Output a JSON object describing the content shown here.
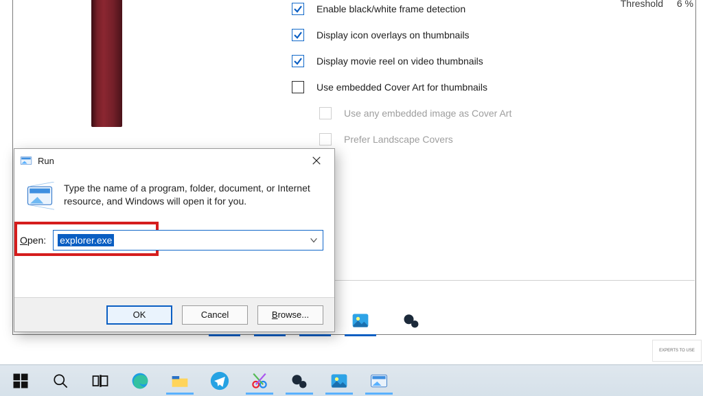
{
  "bg": {
    "options": [
      {
        "label": "Enable black/white frame detection",
        "checked": true,
        "sub": false,
        "faded": false
      },
      {
        "label": "Display icon overlays on thumbnails",
        "checked": true,
        "sub": false,
        "faded": false
      },
      {
        "label": "Display movie reel on video thumbnails",
        "checked": true,
        "sub": false,
        "faded": false
      },
      {
        "label": "Use embedded Cover Art for thumbnails",
        "checked": false,
        "sub": false,
        "faded": false
      },
      {
        "label": "Use any embedded image as Cover Art",
        "checked": false,
        "sub": true,
        "faded": true
      },
      {
        "label": "Prefer Landscape Covers",
        "checked": false,
        "sub": true,
        "faded": true
      }
    ],
    "threshold_label": "Threshold",
    "threshold_value": "6 %"
  },
  "run": {
    "title": "Run",
    "description": "Type the name of a program, folder, document, or Internet resource, and Windows will open it for you.",
    "open_label_prefix": "O",
    "open_label_rest": "pen:",
    "input_value": "explorer.exe",
    "buttons": {
      "ok": "OK",
      "cancel": "Cancel",
      "browse_prefix": "B",
      "browse_rest": "rowse..."
    }
  },
  "taskbar": {
    "items": [
      {
        "name": "start",
        "running": false
      },
      {
        "name": "search",
        "running": false
      },
      {
        "name": "task-view",
        "running": false
      },
      {
        "name": "edge",
        "running": false
      },
      {
        "name": "file-explorer",
        "running": true
      },
      {
        "name": "telegram",
        "running": false
      },
      {
        "name": "snip",
        "running": true
      },
      {
        "name": "app-dark",
        "running": true
      },
      {
        "name": "photos",
        "running": true
      },
      {
        "name": "run-window",
        "running": true
      }
    ]
  },
  "watermark": "EXPERTS TO USE"
}
